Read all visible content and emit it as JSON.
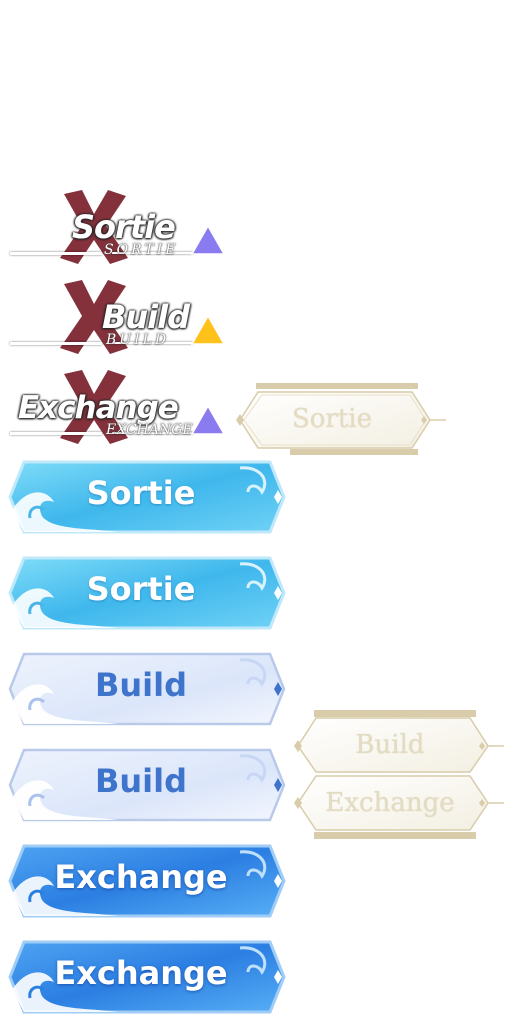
{
  "emblems": [
    {
      "title": "Sortie",
      "subtitle": "SORTIE",
      "triangle_color": "#8a7cf0"
    },
    {
      "title": "Build",
      "subtitle": "BUILD",
      "triangle_color": "#ffc21a"
    },
    {
      "title": "Exchange",
      "subtitle": "EXCHANGE",
      "triangle_color": "#8a7cf0"
    }
  ],
  "wave_buttons": [
    {
      "label": "Sortie",
      "style": "light-blue"
    },
    {
      "label": "Sortie",
      "style": "light-blue"
    },
    {
      "label": "Build",
      "style": "pale-blue"
    },
    {
      "label": "Build",
      "style": "pale-blue"
    },
    {
      "label": "Exchange",
      "style": "deep-blue"
    },
    {
      "label": "Exchange",
      "style": "deep-blue"
    }
  ],
  "cream_buttons": [
    {
      "label": "Sortie"
    },
    {
      "label": "Build"
    },
    {
      "label": "Exchange"
    }
  ],
  "colors": {
    "x_mark": "#7a1f2a",
    "frame_gold": "#d8ccaa",
    "cream_fill": "#fbf9f2",
    "light_blue": "#4cc3ee",
    "pale_blue": "#dfe9fb",
    "deep_blue": "#2f86e6"
  }
}
